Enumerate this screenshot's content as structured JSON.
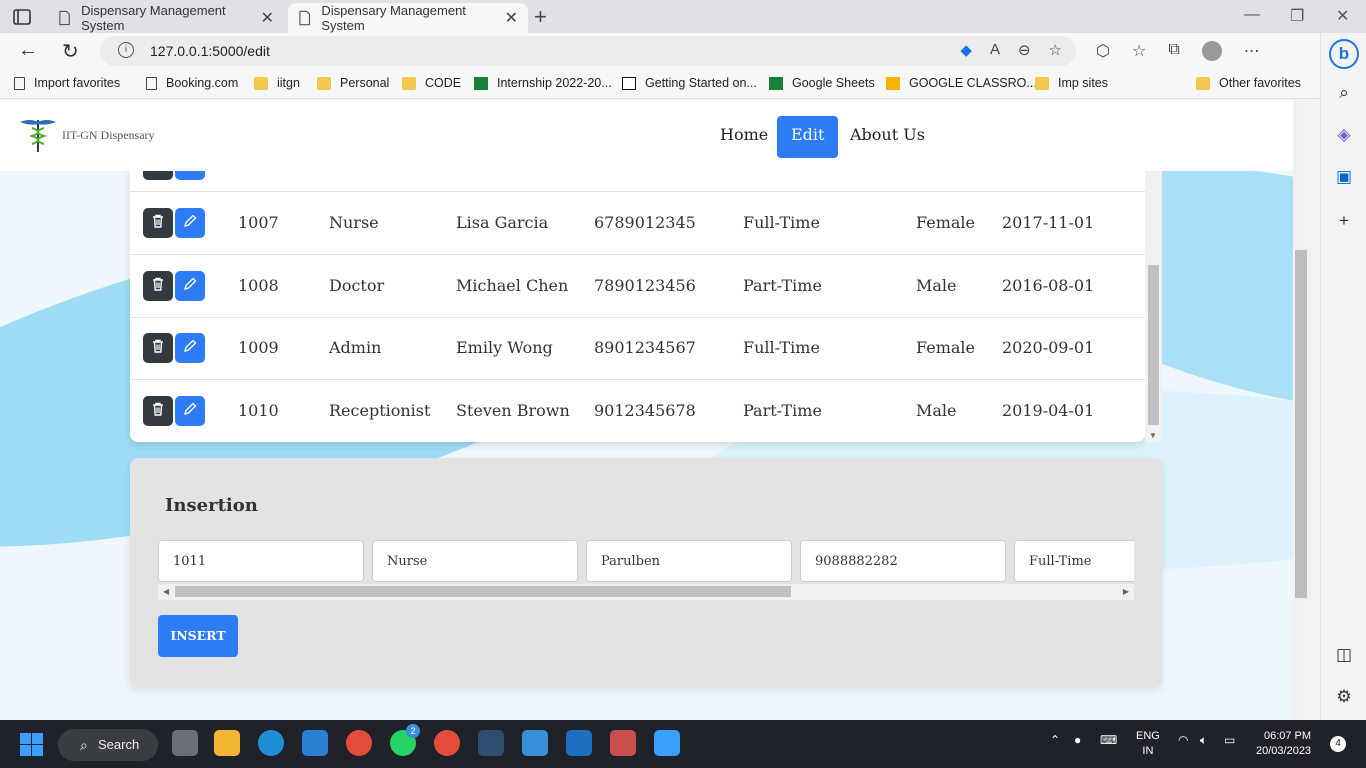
{
  "browser": {
    "tabs": [
      {
        "title": "Dispensary Management System",
        "active": false
      },
      {
        "title": "Dispensary Management System",
        "active": true
      }
    ],
    "url": "127.0.0.1:5000/edit",
    "favorites": [
      {
        "label": "Import favorites",
        "icon": "import-icon"
      },
      {
        "label": "Booking.com",
        "icon": "page-icon"
      },
      {
        "label": "iitgn",
        "icon": "folder-icon"
      },
      {
        "label": "Personal",
        "icon": "folder-icon"
      },
      {
        "label": "CODE",
        "icon": "folder-icon"
      },
      {
        "label": "Internship 2022-20...",
        "icon": "sheets-icon"
      },
      {
        "label": "Getting Started on...",
        "icon": "notion-icon"
      },
      {
        "label": "Google Sheets",
        "icon": "sheets-icon"
      },
      {
        "label": "GOOGLE CLASSRO...",
        "icon": "classroom-icon"
      },
      {
        "label": "Imp sites",
        "icon": "folder-icon"
      },
      {
        "label": "Other favorites",
        "icon": "folder-icon"
      }
    ]
  },
  "site": {
    "logo_text": "IIT-GN Dispensary",
    "nav": [
      {
        "label": "Home",
        "active": false
      },
      {
        "label": "Edit",
        "active": true
      },
      {
        "label": "About Us",
        "active": false
      }
    ]
  },
  "staff_rows": [
    {
      "id": "1007",
      "role": "Nurse",
      "name": "Lisa Garcia",
      "phone": "6789012345",
      "type": "Full-Time",
      "gender": "Female",
      "date": "2017-11-01"
    },
    {
      "id": "1008",
      "role": "Doctor",
      "name": "Michael Chen",
      "phone": "7890123456",
      "type": "Part-Time",
      "gender": "Male",
      "date": "2016-08-01"
    },
    {
      "id": "1009",
      "role": "Admin",
      "name": "Emily Wong",
      "phone": "8901234567",
      "type": "Full-Time",
      "gender": "Female",
      "date": "2020-09-01"
    },
    {
      "id": "1010",
      "role": "Receptionist",
      "name": "Steven Brown",
      "phone": "9012345678",
      "type": "Part-Time",
      "gender": "Male",
      "date": "2019-04-01"
    }
  ],
  "insertion": {
    "title": "Insertion",
    "fields": [
      "1011",
      "Nurse",
      "Parulben",
      "9088882282",
      "Full-Time"
    ],
    "button": "INSERT"
  },
  "taskbar": {
    "search_label": "Search",
    "language": "ENG",
    "region": "IN",
    "time": "06:07 PM",
    "date": "20/03/2023",
    "notification_count": "4",
    "whatsapp_badge": "2"
  },
  "colors": {
    "accent": "#2d7cf6",
    "delete": "#343a40"
  }
}
